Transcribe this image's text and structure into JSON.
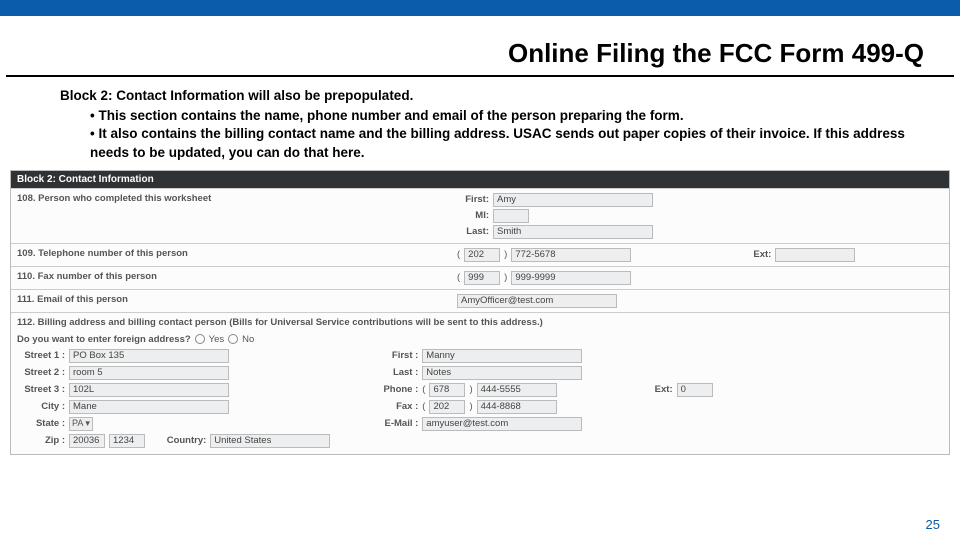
{
  "page_number": "25",
  "title": "Online Filing the FCC Form 499-Q",
  "intro": {
    "lead_bold": "Block 2:",
    "lead_rest": "Contact Information will also be prepopulated.",
    "bullets": [
      "This section contains the name, phone number and email of the person preparing the form.",
      "It also contains the billing contact name and the billing address.  USAC sends out paper copies of their invoice.  If this address needs to be updated, you can do that here."
    ]
  },
  "form": {
    "block_header": "Block 2: Contact Information",
    "r108": {
      "label": "108. Person who completed this worksheet",
      "first_l": "First:",
      "first": "Amy",
      "mi_l": "MI:",
      "mi": "",
      "last_l": "Last:",
      "last": "Smith"
    },
    "r109": {
      "label": "109. Telephone number of this person",
      "area": "202",
      "num": "772-5678",
      "ext_l": "Ext:",
      "ext": ""
    },
    "r110": {
      "label": "110. Fax number of this person",
      "area": "999",
      "num": "999-9999"
    },
    "r111": {
      "label": "111. Email of this person",
      "email": "AmyOfficer@test.com"
    },
    "r112": {
      "header": "112. Billing address and billing contact person (Bills for Universal Service contributions will be sent to this address.)",
      "foreign_q": "Do you want to enter foreign address?",
      "yes": "Yes",
      "no": "No",
      "street1_l": "Street 1 :",
      "street1": "PO Box 135",
      "street2_l": "Street 2 :",
      "street2": "room 5",
      "street3_l": "Street 3 :",
      "street3": "102L",
      "city_l": "City :",
      "city": "Mane",
      "state_l": "State :",
      "state": "PA ▾",
      "zip_l": "Zip :",
      "zip1": "20036",
      "zip2": "1234",
      "country_l": "Country:",
      "country": "United States",
      "bfirst_l": "First :",
      "bfirst": "Manny",
      "blast_l": "Last :",
      "blast": "Notes",
      "phone_l": "Phone :",
      "phone_a": "678",
      "phone_n": "444-5555",
      "phone_ext_l": "Ext:",
      "phone_ext": "0",
      "fax_l": "Fax :",
      "fax_a": "202",
      "fax_n": "444-8868",
      "email_l": "E-Mail :",
      "email": "amyuser@test.com"
    }
  }
}
